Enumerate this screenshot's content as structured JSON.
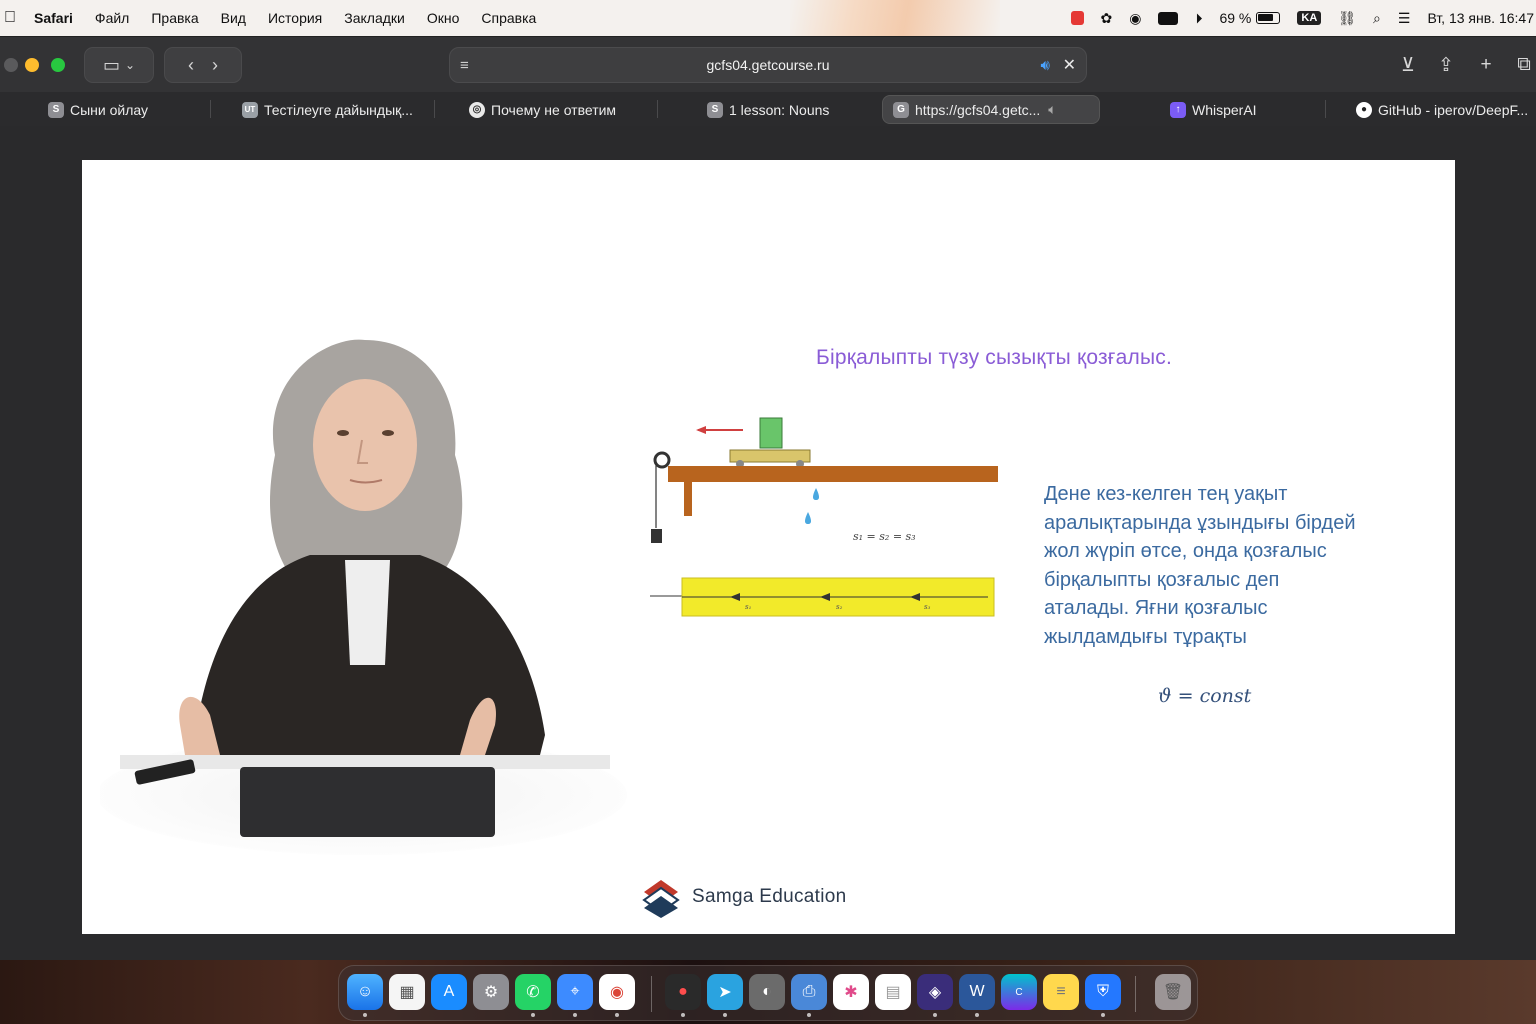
{
  "menubar": {
    "app": "Safari",
    "items": [
      "Файл",
      "Правка",
      "Вид",
      "История",
      "Закладки",
      "Окно",
      "Справка"
    ],
    "battery": "69 %",
    "keyboard": "KA",
    "clock": "Вт, 13 янв. 16:47"
  },
  "toolbar": {
    "url": "gcfs04.getcourse.ru"
  },
  "tabs": [
    {
      "label": "Сыни ойлау",
      "fav": "S",
      "color": "#8e8e93"
    },
    {
      "label": "Тестілеуге дайындық...",
      "fav": "UT",
      "color": "#9aa0a6"
    },
    {
      "label": "Почему не ответим",
      "fav": "◎",
      "color": "#555"
    },
    {
      "label": "1 lesson: Nouns",
      "fav": "S",
      "color": "#8e8e93"
    },
    {
      "label": "https://gcfs04.getc...",
      "fav": "G",
      "color": "#8e8e93"
    },
    {
      "label": "WhisperAI",
      "fav": "↑",
      "color": "#7b5cf5"
    },
    {
      "label": "GitHub - iperov/DeepF...",
      "fav": "●",
      "color": "#fff"
    }
  ],
  "slide": {
    "title": "Бірқалыпты түзу сызықты қозғалыс.",
    "body": "Дене кез-келген тең уақыт аралықтарында ұзындығы бірдей жол жүріп өтсе, онда қозғалыс бірқалыпты қозғалыс деп аталады. Яғни қозғалыс жылдамдығы тұрақты",
    "formula": "ϑ = const",
    "diagram_label": "s₁ = s₂ = s₃",
    "sub_labels": [
      "s₁",
      "s₂",
      "s₃"
    ],
    "logo_text": "Samga Education"
  },
  "colors": {
    "title": "#8a5cd6",
    "body": "#3b6aa0",
    "table": "#b8641e",
    "strip": "#f2ea2a"
  }
}
